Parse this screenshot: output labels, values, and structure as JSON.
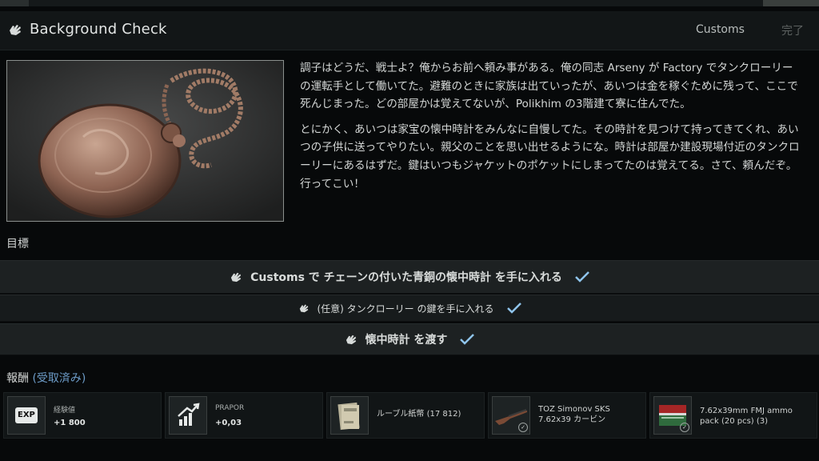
{
  "quest": {
    "title": "Background Check",
    "location": "Customs",
    "status": "完了",
    "description": [
      "調子はどうだ、戦士よ？俺からお前へ頼み事がある。俺の同志 Arseny が Factory でタンクローリーの運転手として働いてた。避難のときに家族は出ていったが、あいつは金を稼ぐために残って、ここで死んじまった。どの部屋かは覚えてないが、Polikhim の3階建て寮に住んでた。",
      "とにかく、あいつは家宝の懐中時計をみんなに自慢してた。その時計を見つけて持ってきてくれ、あいつの子供に送ってやりたい。親父のことを思い出せるようにな。時計は部屋か建設現場付近のタンクローリーにあるはずだ。鍵はいつもジャケットのポケットにしまってたのは覚えてる。さて、頼んだぞ。行ってこい！"
    ]
  },
  "objectives": {
    "label": "目標",
    "items": [
      {
        "text": "Customs で チェーンの付いた青銅の懐中時計 を手に入れる"
      },
      {
        "text": "(任意) タンクローリー の鍵を手に入れる"
      },
      {
        "text": "懐中時計 を渡す"
      }
    ]
  },
  "rewards": {
    "label": "報酬",
    "status": "(受取済み)",
    "items": [
      {
        "icon": "exp-icon",
        "icon_text": "EXP",
        "name": "経験値",
        "value": "+1 800"
      },
      {
        "icon": "reputation-up-icon",
        "name": "PRAPOR",
        "value": "+0,03"
      },
      {
        "icon": "rouble-notes-icon",
        "text": "ルーブル紙幣 (17 812)"
      },
      {
        "icon": "sks-rifle-icon",
        "text": "TOZ Simonov SKS 7.62x39 カービン"
      },
      {
        "icon": "ammo-pack-icon",
        "text": "7.62x39mm FMJ ammo pack (20 pcs) (3)"
      }
    ]
  },
  "colors": {
    "accent": "#6d9cc8",
    "check": "#8fc4ec",
    "background": "#07090a",
    "row": "#1d2122"
  }
}
